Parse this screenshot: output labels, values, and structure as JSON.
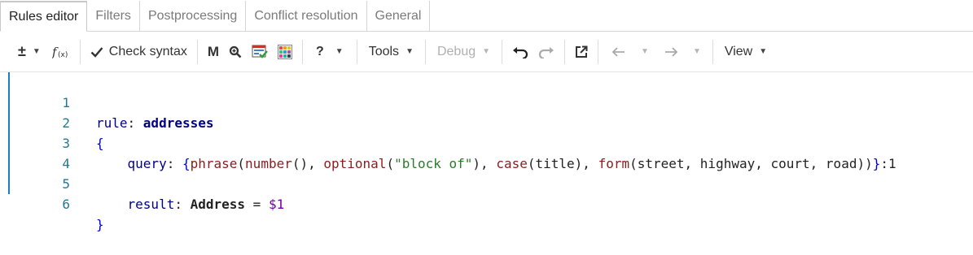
{
  "tabs": [
    {
      "label": "Rules editor",
      "active": true
    },
    {
      "label": "Filters",
      "active": false
    },
    {
      "label": "Postprocessing",
      "active": false
    },
    {
      "label": "Conflict resolution",
      "active": false
    },
    {
      "label": "General",
      "active": false
    }
  ],
  "toolbar": {
    "check_syntax_label": "Check syntax",
    "m_label": "M",
    "help_label": "?",
    "tools_label": "Tools",
    "debug_label": "Debug",
    "view_label": "View",
    "plusminus_label": "±"
  },
  "editor": {
    "accent_color": "#1a7ec4",
    "lines": [
      {
        "number": "1"
      },
      {
        "number": "2"
      },
      {
        "number": "3"
      },
      {
        "number": "4"
      },
      {
        "number": "5"
      },
      {
        "number": "6"
      }
    ],
    "line1": {
      "kw": "rule",
      "colon": ": ",
      "name": "addresses"
    },
    "line2": {
      "brace": "{"
    },
    "line3": {
      "indent": "    ",
      "key": "query",
      "colon": ": ",
      "open": "{",
      "fn1": "phrase",
      "p1": "(",
      "fn2": "number",
      "p2": "(), ",
      "fn3": "optional",
      "p3": "(",
      "str": "\"block of\"",
      "p4": "), ",
      "fn4": "case",
      "p5": "(",
      "arg1": "title",
      "p6": "), ",
      "fn5": "form",
      "p7": "(",
      "args": "street, highway, court, road",
      "p8": "))",
      "close": "}",
      "suffix": ":1"
    },
    "line5": {
      "indent": "    ",
      "key": "result",
      "colon": ": ",
      "type": "Address",
      "eq": " = ",
      "var": "$1"
    },
    "line6": {
      "brace": "}"
    }
  }
}
